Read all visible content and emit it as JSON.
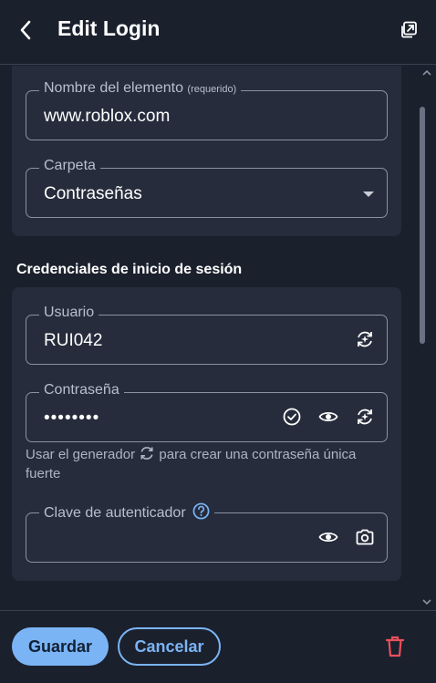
{
  "header": {
    "title": "Edit Login",
    "back_icon": "chevron-left-icon",
    "popout_icon": "popout-icon"
  },
  "item": {
    "name_label": "Nombre del elemento",
    "name_required": "(requerido)",
    "name_value": "www.roblox.com",
    "folder_label": "Carpeta",
    "folder_value": "Contraseñas"
  },
  "credentials": {
    "heading": "Credenciales de inicio de sesión",
    "username_label": "Usuario",
    "username_value": "RUI042",
    "password_label": "Contraseña",
    "password_value": "••••••••",
    "hint_before": "Usar el generador",
    "hint_after": "para crear una contraseña única fuerte",
    "totp_label": "Clave de autenticador",
    "totp_value": ""
  },
  "footer": {
    "save_label": "Guardar",
    "cancel_label": "Cancelar"
  },
  "colors": {
    "accent": "#7ab4f5",
    "danger": "#e8505b",
    "background": "#1b202d",
    "card": "#262c3b"
  }
}
